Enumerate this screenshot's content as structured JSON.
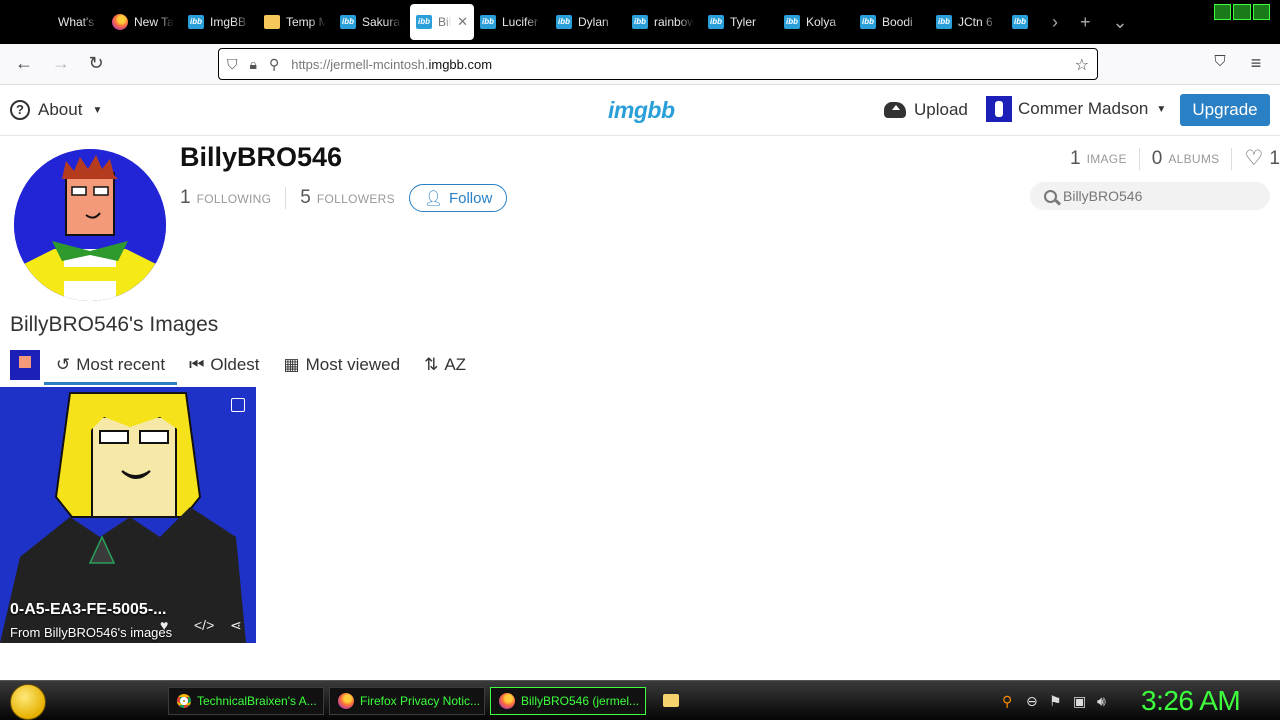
{
  "browser": {
    "tabs": [
      {
        "label": "What's new",
        "icon": "blank-icon",
        "active": false
      },
      {
        "label": "New Tab",
        "icon": "firefox-icon",
        "active": false
      },
      {
        "label": "ImgBB",
        "icon": "imgbb-icon",
        "active": false
      },
      {
        "label": "Temp Mail",
        "icon": "mail-icon",
        "active": false
      },
      {
        "label": "Sakura",
        "icon": "imgbb-icon",
        "active": false
      },
      {
        "label": "Bil",
        "icon": "imgbb-icon",
        "active": true
      },
      {
        "label": "Lucifer",
        "icon": "imgbb-icon",
        "active": false
      },
      {
        "label": "Dylan",
        "icon": "imgbb-icon",
        "active": false
      },
      {
        "label": "rainbow",
        "icon": "imgbb-icon",
        "active": false
      },
      {
        "label": "Tyler",
        "icon": "imgbb-icon",
        "active": false
      },
      {
        "label": "Kolya",
        "icon": "imgbb-icon",
        "active": false
      },
      {
        "label": "Boodi",
        "icon": "imgbb-icon",
        "active": false
      },
      {
        "label": "JCtn 6",
        "icon": "imgbb-icon",
        "active": false
      },
      {
        "label": "",
        "icon": "imgbb-icon",
        "active": false
      }
    ],
    "url_prefix": "https://jermell-mcintosh.",
    "url_host": "imgbb.com"
  },
  "site": {
    "about_label": "About",
    "logo": "imgbb",
    "upload_label": "Upload",
    "user_name": "Commer Madson",
    "upgrade_label": "Upgrade"
  },
  "profile": {
    "username": "BillyBRO546",
    "following_count": "1",
    "following_label": "FOLLOWING",
    "followers_count": "5",
    "followers_label": "FOLLOWERS",
    "follow_label": "Follow",
    "image_count": "1",
    "image_label": "IMAGE",
    "album_count": "0",
    "album_label": "ALBUMS",
    "likes_count": "1",
    "search_placeholder": "BillyBRO546"
  },
  "images_section": {
    "title": "BillyBRO546's Images",
    "sort_tabs": [
      {
        "label": "Most recent",
        "icon": "history-icon",
        "active": true
      },
      {
        "label": "Oldest",
        "icon": "rewind-icon",
        "active": false
      },
      {
        "label": "Most viewed",
        "icon": "bar-chart-icon",
        "active": false
      },
      {
        "label": "AZ",
        "icon": "sort-az-icon",
        "active": false
      }
    ],
    "card": {
      "title": "0-A5-EA3-FE-5005-...",
      "subtitle": "From BillyBRO546's images"
    }
  },
  "taskbar": {
    "tasks": [
      {
        "label": "TechnicalBraixen's A...",
        "icon": "chrome-icon"
      },
      {
        "label": "Firefox Privacy Notic...",
        "icon": "firefox-icon"
      },
      {
        "label": "BillyBRO546 (jermel...",
        "icon": "firefox-icon",
        "active": true
      }
    ],
    "clock": "3:26 AM"
  },
  "colors": {
    "accent": "#2980c4",
    "logo": "#2a9fd8",
    "taskbar_text": "#3dff3d"
  }
}
